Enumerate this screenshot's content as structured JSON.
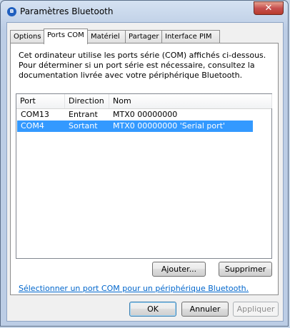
{
  "window": {
    "title": "Paramètres Bluetooth",
    "close_label": "✕"
  },
  "tabs": [
    {
      "label": "Options"
    },
    {
      "label": "Ports COM"
    },
    {
      "label": "Matériel"
    },
    {
      "label": "Partager"
    },
    {
      "label": "Interface PIM"
    }
  ],
  "active_tab": "Ports COM",
  "description": "Cet ordinateur utilise les ports série (COM) affichés ci-dessous. Pour déterminer si un port série est nécessaire, consultez la documentation livrée avec votre périphérique Bluetooth.",
  "table": {
    "headers": [
      "Port",
      "Direction",
      "Nom"
    ],
    "rows": [
      {
        "port": "COM13",
        "direction": "Entrant",
        "name": "MTX0 00000000"
      },
      {
        "port": "COM4",
        "direction": "Sortant",
        "name": "MTX0 00000000 'Serial port'"
      }
    ],
    "selected_row": 1
  },
  "buttons": {
    "add": "Ajouter...",
    "remove": "Supprimer",
    "ok": "OK",
    "cancel": "Annuler",
    "apply": "Appliquer"
  },
  "link_text": "Sélectionner un port COM pour un périphérique Bluetooth.",
  "colors": {
    "selection": "#3399ff",
    "link": "#0066cc",
    "close_button": "#c75050"
  }
}
